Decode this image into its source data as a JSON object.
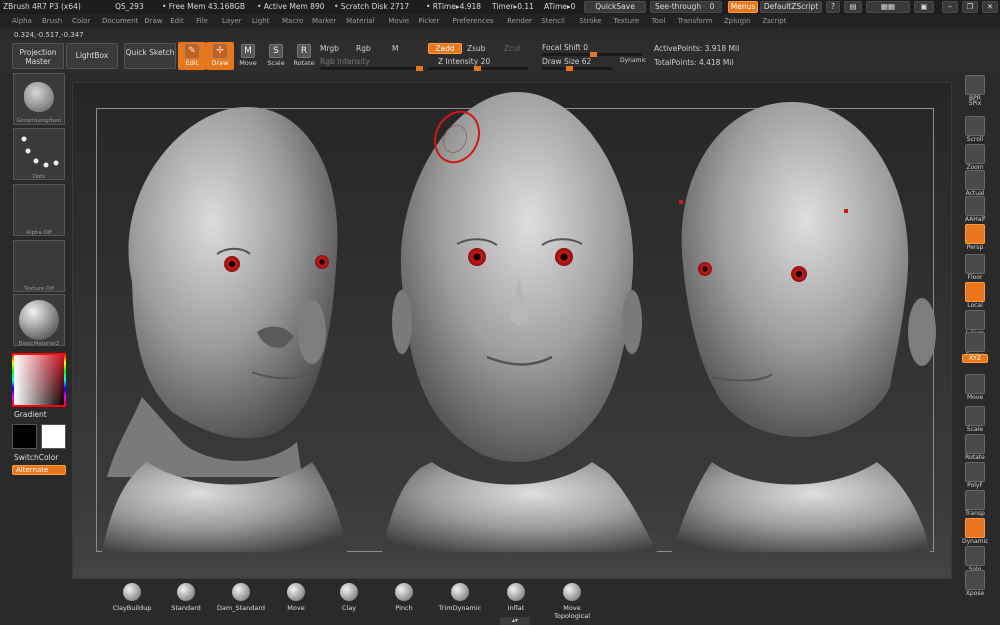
{
  "titlebar": {
    "app": "ZBrush 4R7 P3 (x64)",
    "qs": "QS_293",
    "free_mem": "• Free Mem 43.168GB",
    "active_mem": "• Active Mem 890",
    "scratch": "• Scratch Disk 2717",
    "rtime": "• RTime▸4.918",
    "timer": "Timer▸0.11",
    "atime": "ATime▸0",
    "quicksave": "QuickSave",
    "see_through": "See-through",
    "see_through_value": "0",
    "menus": "Menus",
    "script": "DefaultZScript"
  },
  "menus": [
    "Alpha",
    "Brush",
    "Color",
    "Document",
    "Draw",
    "Edit",
    "File",
    "Layer",
    "Light",
    "Macro",
    "Marker",
    "Material",
    "Movie",
    "Picker",
    "Preferences",
    "Render",
    "Stencil",
    "Stroke",
    "Texture",
    "Tool",
    "Transform",
    "Zplugin",
    "Zscript"
  ],
  "coords": "0.324,-0.517,-0.347",
  "toolbar": {
    "projection_master": "Projection Master",
    "lightbox": "LightBox",
    "quick_sketch": "Quick Sketch",
    "edit": "Edit",
    "draw": "Draw",
    "move": "Move",
    "scale": "Scale",
    "rotate": "Rotate",
    "mrgb": "Mrgb",
    "rgb": "Rgb",
    "m": "M",
    "rgb_intensity": "Rgb Intensity",
    "zadd": "Zadd",
    "zsub": "Zsub",
    "zcut": "Zcut",
    "z_intensity_label": "Z Intensity",
    "z_intensity_value": "20",
    "focal_label": "Focal Shift",
    "focal_value": "0",
    "draw_size_label": "Draw Size",
    "draw_size_value": "62",
    "dynamic": "Dynamic",
    "active_points_label": "ActivePoints:",
    "active_points_value": "3.918 Mil",
    "total_points_label": "TotalPoints:",
    "total_points_value": "4.418 Mil"
  },
  "left_shelf": {
    "brush_label": "GroomLengthen",
    "stroke_label": "Dots",
    "alpha_label": "Alpha Off",
    "texture_label": "Texture Off",
    "material_label": "BasicMaterial2",
    "gradient": "Gradient",
    "switch_color": "SwitchColor",
    "alternate": "Alternate"
  },
  "right_shelf": [
    "BPR",
    "SPix",
    "Scroll",
    "Zoom",
    "Actual",
    "AAHalf",
    "Persp",
    "Floor",
    "Local",
    "L.Sym",
    "Frame",
    "Move",
    "Scale",
    "Rotate",
    "PolyF",
    "Transp",
    "Dynamic",
    "Solo",
    "Xpose"
  ],
  "right_shelf_extra": {
    "xyz": "XYZ"
  },
  "brushes": [
    "ClayBuildup",
    "Standard",
    "Dam_Standard",
    "Move",
    "Clay",
    "Pinch",
    "TrimDynamic",
    "Inflat",
    "Move Topological"
  ],
  "colors": {
    "accent": "#e8761c",
    "eye": "#cc1a1a",
    "head": "#9a9a9a"
  }
}
